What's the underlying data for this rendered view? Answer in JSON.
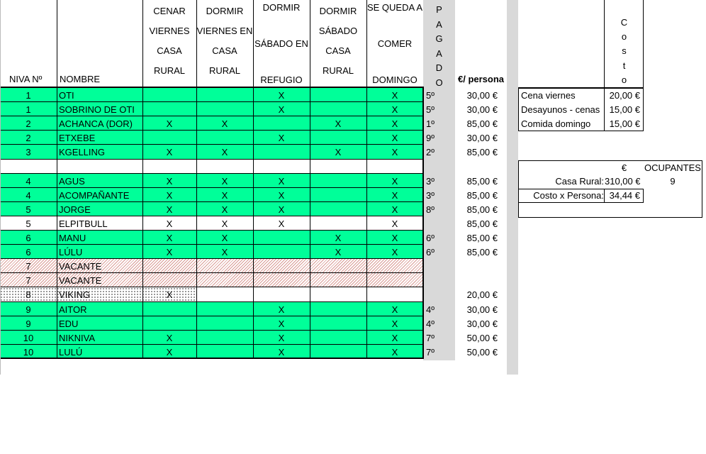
{
  "headers": {
    "niva": "NIVA Nº",
    "nombre": "NOMBRE",
    "cenar_viernes": [
      "CENAR",
      "VIERNES",
      "CASA",
      "RURAL"
    ],
    "dormir_viernes": [
      "DORMIR",
      "VIERNES EN",
      "CASA",
      "RURAL"
    ],
    "dormir_sabado_refugio": [
      "DORMIR",
      "SÁBADO EN",
      "REFUGIO"
    ],
    "dormir_sabado_rural": [
      "DORMIR",
      "SÁBADO",
      "CASA",
      "RURAL"
    ],
    "se_queda": [
      "SE QUEDA A",
      "COMER",
      "DOMINGO"
    ],
    "pagado": [
      "P",
      "A",
      "G",
      "A",
      "D",
      "O"
    ],
    "euro_persona": "€/ persona"
  },
  "rows": [
    {
      "niva": "1",
      "nombre": "OTI",
      "c1": "",
      "c2": "",
      "c3": "X",
      "c4": "",
      "c5": "X",
      "pagado": "5º",
      "precio": "30,00 €",
      "style": "green"
    },
    {
      "niva": "1",
      "nombre": "SOBRINO DE OTI",
      "c1": "",
      "c2": "",
      "c3": "X",
      "c4": "",
      "c5": "X",
      "pagado": "5º",
      "precio": "30,00 €",
      "style": "green"
    },
    {
      "niva": "2",
      "nombre": "ACHANCA (DOR)",
      "c1": "X",
      "c2": "X",
      "c3": "",
      "c4": "X",
      "c5": "X",
      "pagado": "1º",
      "precio": "85,00 €",
      "style": "green"
    },
    {
      "niva": "2",
      "nombre": "ETXEBE",
      "c1": "",
      "c2": "",
      "c3": "X",
      "c4": "",
      "c5": "X",
      "pagado": "9º",
      "precio": "30,00 €",
      "style": "green"
    },
    {
      "niva": "3",
      "nombre": "KGELLING",
      "c1": "X",
      "c2": "X",
      "c3": "",
      "c4": "X",
      "c5": "X",
      "pagado": "2º",
      "precio": "85,00 €",
      "style": "green"
    },
    {
      "niva": "",
      "nombre": "",
      "c1": "",
      "c2": "",
      "c3": "",
      "c4": "",
      "c5": "",
      "pagado": "",
      "precio": "",
      "style": "white"
    },
    {
      "niva": "4",
      "nombre": "AGUS",
      "c1": "X",
      "c2": "X",
      "c3": "X",
      "c4": "",
      "c5": "X",
      "pagado": "3º",
      "precio": "85,00 €",
      "style": "green"
    },
    {
      "niva": "4",
      "nombre": "ACOMPAÑANTE",
      "c1": "X",
      "c2": "X",
      "c3": "X",
      "c4": "",
      "c5": "X",
      "pagado": "3º",
      "precio": "85,00 €",
      "style": "green"
    },
    {
      "niva": "5",
      "nombre": "JORGE",
      "c1": "X",
      "c2": "X",
      "c3": "X",
      "c4": "",
      "c5": "X",
      "pagado": "8º",
      "precio": "85,00 €",
      "style": "green"
    },
    {
      "niva": "5",
      "nombre": "ELPITBULL",
      "c1": "X",
      "c2": "X",
      "c3": "X",
      "c4": "",
      "c5": "X",
      "pagado": "",
      "precio": "85,00 €",
      "style": "white"
    },
    {
      "niva": "6",
      "nombre": "MANU",
      "c1": "X",
      "c2": "X",
      "c3": "",
      "c4": "X",
      "c5": "X",
      "pagado": "6º",
      "precio": "85,00 €",
      "style": "green"
    },
    {
      "niva": "6",
      "nombre": "LÚLU",
      "c1": "X",
      "c2": "X",
      "c3": "",
      "c4": "X",
      "c5": "X",
      "pagado": "6º",
      "precio": "85,00 €",
      "style": "green"
    },
    {
      "niva": "7",
      "nombre": "VACANTE",
      "c1": "",
      "c2": "",
      "c3": "",
      "c4": "",
      "c5": "",
      "pagado": "",
      "precio": "",
      "style": "hatch"
    },
    {
      "niva": "7",
      "nombre": "VACANTE",
      "c1": "",
      "c2": "",
      "c3": "",
      "c4": "",
      "c5": "",
      "pagado": "",
      "precio": "",
      "style": "hatch"
    },
    {
      "niva": "8",
      "nombre": "VIKING",
      "c1": "X",
      "c2": "",
      "c3": "",
      "c4": "",
      "c5": "",
      "pagado": "",
      "precio": "20,00 €",
      "style": "dots"
    },
    {
      "niva": "9",
      "nombre": "AITOR",
      "c1": "",
      "c2": "",
      "c3": "X",
      "c4": "",
      "c5": "X",
      "pagado": "4º",
      "precio": "30,00 €",
      "style": "green"
    },
    {
      "niva": "9",
      "nombre": "EDU",
      "c1": "",
      "c2": "",
      "c3": "X",
      "c4": "",
      "c5": "X",
      "pagado": "4º",
      "precio": "30,00 €",
      "style": "green"
    },
    {
      "niva": "10",
      "nombre": "NIKNIVA",
      "c1": "X",
      "c2": "",
      "c3": "X",
      "c4": "",
      "c5": "X",
      "pagado": "7º",
      "precio": "50,00 €",
      "style": "green"
    },
    {
      "niva": "10",
      "nombre": "LULÚ",
      "c1": "X",
      "c2": "",
      "c3": "X",
      "c4": "",
      "c5": "X",
      "pagado": "7º",
      "precio": "50,00 €",
      "style": "green"
    }
  ],
  "costs": {
    "header": [
      "C",
      "o",
      "s",
      "t",
      "o"
    ],
    "items": [
      {
        "label": "Cena viernes",
        "value": "20,00 €"
      },
      {
        "label": "Desayunos - cenas",
        "value": "15,00 €"
      },
      {
        "label": "Comida domingo",
        "value": "15,00 €"
      }
    ]
  },
  "summary": {
    "euro_header": "€",
    "ocupantes_header": "OCUPANTES",
    "casa_rural_label": "Casa Rural:",
    "casa_rural_value": "310,00 €",
    "ocupantes_value": "9",
    "costo_persona_label": "Costo x Persona:",
    "costo_persona_value": "34,44 €"
  },
  "colors": {
    "row_green": "#00FF99",
    "pagado_gray": "#D9D9D9",
    "hatch": "#D99A94"
  }
}
